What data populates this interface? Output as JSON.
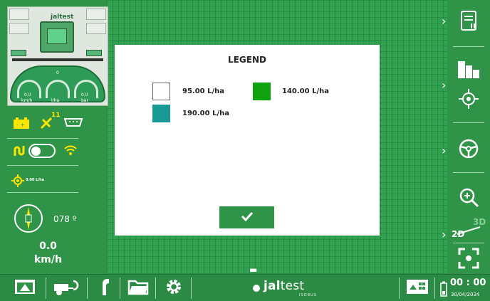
{
  "modal": {
    "title": "LEGEND",
    "items": [
      {
        "label": "95.00 L/ha",
        "color": "#ffffff"
      },
      {
        "label": "140.00 L/ha",
        "color": "#0ea30e"
      },
      {
        "label": "190.00 L/ha",
        "color": "#1a9a97"
      }
    ],
    "confirm_icon": "check-icon"
  },
  "left_panel": {
    "logo": "jaltest",
    "gauge_values": {
      "left": "0.0",
      "center": "0",
      "right": "0.0"
    },
    "gauge_units": {
      "left": "km/h",
      "center": "l/ha",
      "right": "bar"
    },
    "satellite_count": "11",
    "rate": "0.00 L/ha",
    "heading": "078 º",
    "speed_value": "0.0",
    "speed_unit": "km/h"
  },
  "right_panel": {
    "buttons": [
      "report-icon",
      "map-layers-icon",
      "gps-center-icon",
      "steering-wheel-icon",
      "zoom-in-icon",
      "view-2d-3d-icon",
      "focus-icon"
    ],
    "view_2d": "2D",
    "view_3d": "3D"
  },
  "bottom_bar": {
    "brand_bold": "jal",
    "brand_light": "test",
    "brand_sub": "ISOBUS",
    "time": "00 : 00",
    "date": "30/04/2024"
  },
  "colors": {
    "accent": "#2f9447",
    "map": "#31a04f"
  }
}
